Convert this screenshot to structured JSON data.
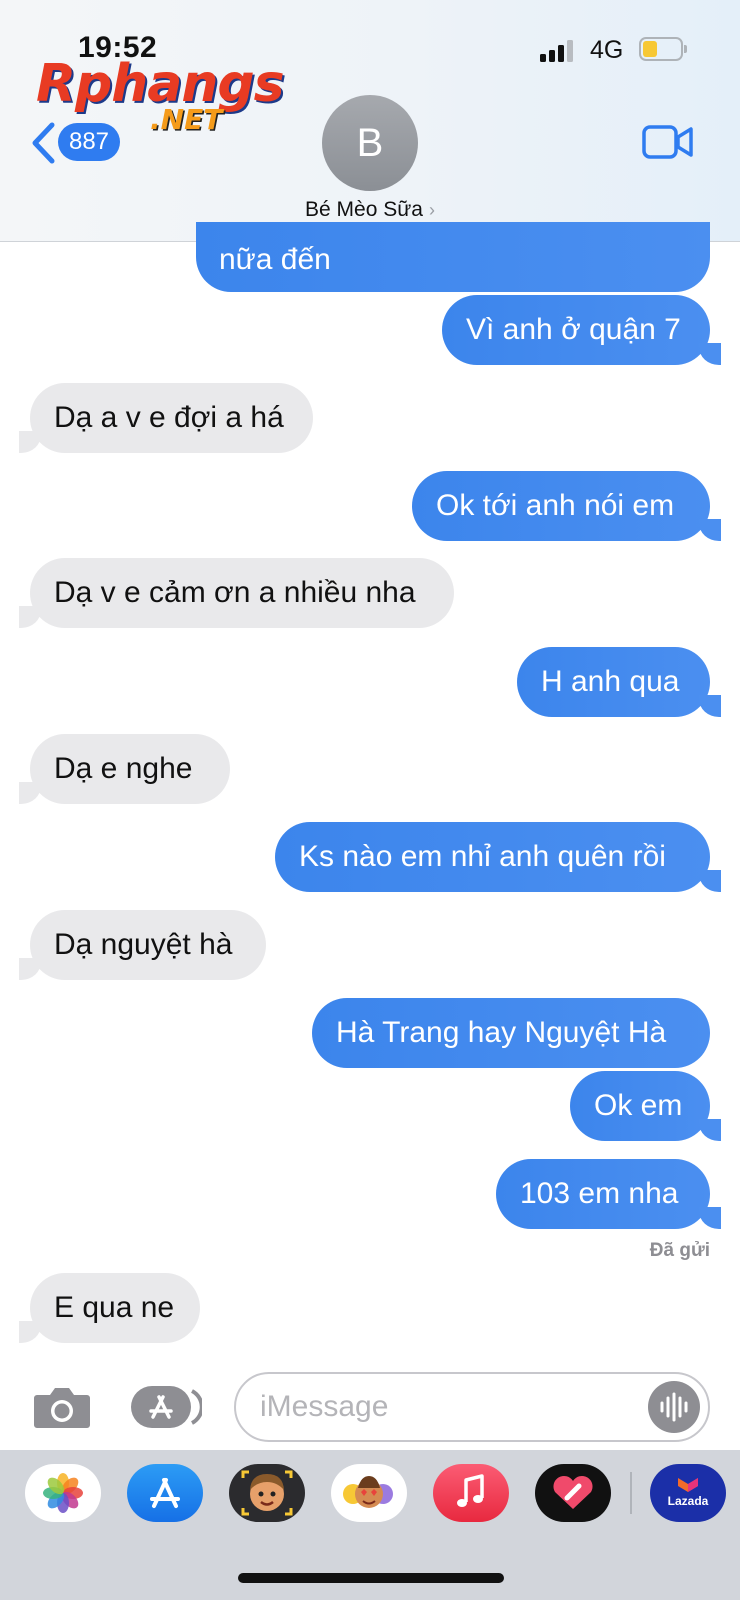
{
  "status_bar": {
    "time": "19:52",
    "network": "4G"
  },
  "watermark": {
    "top": "Rphangs",
    "bottom": ".NET"
  },
  "header": {
    "back_count": "887",
    "avatar_initial": "B",
    "contact_name": "Bé Mèo Sữa",
    "contact_chevron": "›"
  },
  "messages": [
    {
      "text": "nữa đến",
      "direction": "outgoing"
    },
    {
      "text": "Vì anh ở quận 7",
      "direction": "outgoing"
    },
    {
      "text": "Dạ a v e đợi a há",
      "direction": "incoming"
    },
    {
      "text": "Ok tới anh nói em",
      "direction": "outgoing"
    },
    {
      "text": "Dạ v e cảm ơn a nhiều nha",
      "direction": "incoming"
    },
    {
      "text": "H anh qua",
      "direction": "outgoing"
    },
    {
      "text": "Dạ e nghe",
      "direction": "incoming"
    },
    {
      "text": "Ks nào em nhỉ anh quên rồi",
      "direction": "outgoing"
    },
    {
      "text": "Dạ nguyệt hà",
      "direction": "incoming"
    },
    {
      "text": "Hà Trang hay Nguyệt Hà",
      "direction": "outgoing"
    },
    {
      "text": "Ok em",
      "direction": "outgoing"
    },
    {
      "text": "103 em nha",
      "direction": "outgoing"
    },
    {
      "text": "E qua ne",
      "direction": "incoming"
    }
  ],
  "delivered_label": "Đã gửi",
  "composer": {
    "placeholder": "iMessage"
  },
  "app_drawer": {
    "apps": [
      "photos-icon",
      "app-store-icon",
      "memoji-icon",
      "animoji-stickers-icon",
      "music-icon",
      "digital-touch-icon",
      "lazada-icon"
    ],
    "lazada_label": "Lazada"
  },
  "colors": {
    "outgoing_bubble": "#3c85ec",
    "incoming_bubble": "#e9e9eb",
    "badge": "#2f7cf0",
    "accent": "#2f7cf0"
  }
}
